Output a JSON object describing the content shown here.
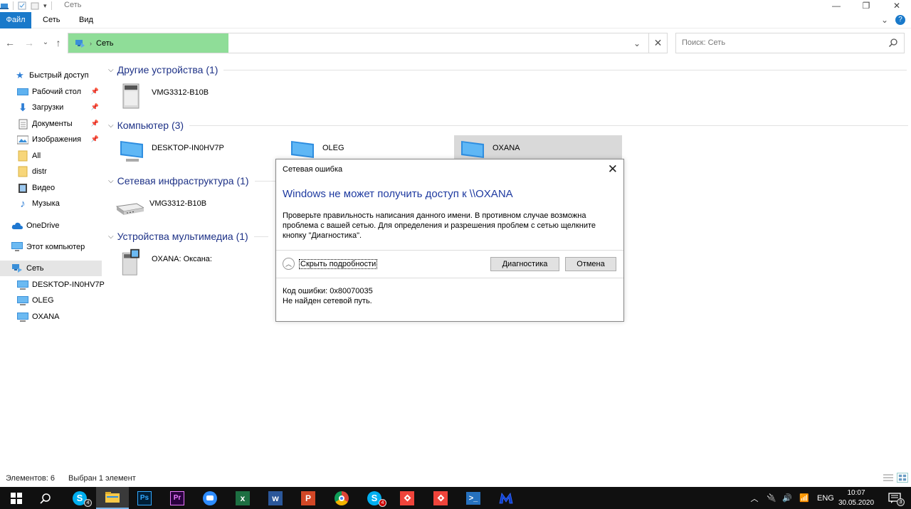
{
  "window": {
    "title": "Сеть",
    "minimize": "—",
    "maximize": "❐",
    "close": "✕"
  },
  "ribbon": {
    "tabs": [
      "Файл",
      "Сеть",
      "Вид"
    ],
    "collapse": "⌄",
    "help": "?"
  },
  "address": {
    "breadcrumb": "Сеть",
    "dropdown": "⌄",
    "clear": "✕"
  },
  "search": {
    "placeholder": "Поиск: Сеть"
  },
  "nav": {
    "back": "←",
    "forward": "→",
    "recent": "⌄",
    "up": "↑"
  },
  "navpane": {
    "quick_access": "Быстрый доступ",
    "desktop": "Рабочий стол",
    "downloads": "Загрузки",
    "documents": "Документы",
    "pictures": "Изображения",
    "all": "All",
    "distr": "distr",
    "video": "Видео",
    "music": "Музыка",
    "onedrive": "OneDrive",
    "this_pc": "Этот компьютер",
    "network": "Сеть",
    "pc1": "DESKTOP-IN0HV7P",
    "pc2": "OLEG",
    "pc3": "OXANA"
  },
  "groups": {
    "other": "Другие устройства (1)",
    "computer": "Компьютер (3)",
    "infra": "Сетевая инфраструктура (1)",
    "media": "Устройства мультимедиа (1)"
  },
  "items": {
    "other_device": "VMG3312-B10B",
    "comp1": "DESKTOP-IN0HV7P",
    "comp2": "OLEG",
    "comp3": "OXANA",
    "router": "VMG3312-B10B",
    "media_device": "OXANA: Оксана:"
  },
  "dialog": {
    "title": "Сетевая ошибка",
    "heading": "Windows не может получить доступ к \\\\OXANA",
    "message_line1": "Проверьте правильность написания данного имени. В противном случае возможна",
    "message_line2": "проблема с вашей сетью. Для определения и разрешения проблем с сетью щелкните",
    "message_line3": "кнопку \"Диагностика\".",
    "toggle": "Скрыть подробности",
    "diagnose": "Диагностика",
    "cancel": "Отмена",
    "error_code": "Код ошибки: 0x80070035",
    "error_text": "Не найден сетевой путь.",
    "close": "✕"
  },
  "status": {
    "items": "Элементов: 6",
    "selected": "Выбран 1 элемент"
  },
  "taskbar": {
    "skype_badge": "4",
    "skype2_badge": "4",
    "ps": "Ps",
    "pr": "Pr",
    "excel": "x",
    "word": "w",
    "ppt": "P",
    "lang": "ENG",
    "time": "10:07",
    "date": "30.05.2020",
    "notif_badge": "3"
  },
  "colors": {
    "accent": "#1979ca",
    "address_fill": "#8fdd98",
    "group_heading": "#1e3287",
    "dialog_heading": "#1e3aa0"
  }
}
